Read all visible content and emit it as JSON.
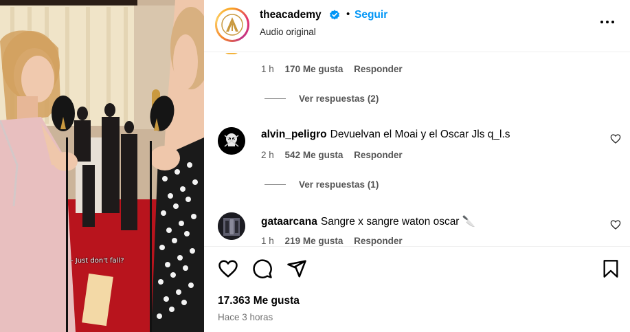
{
  "video": {
    "caption": "- Just don't fall?"
  },
  "header": {
    "username": "theacademy",
    "separator": "•",
    "follow_label": "Seguir",
    "subtitle": "Audio original",
    "more_icon": "more-horizontal-icon",
    "verified_icon": "verified-badge-icon"
  },
  "comments": {
    "top": {
      "time": "1 h",
      "likes": "170 Me gusta",
      "reply": "Responder",
      "view_replies": "Ver respuestas (2)"
    },
    "items": [
      {
        "username": "alvin_peligro",
        "text": "Devuelvan el Moai y el Oscar Jls q_l.s",
        "time": "2 h",
        "likes": "542 Me gusta",
        "reply": "Responder",
        "view_replies": "Ver respuestas (1)"
      },
      {
        "username": "gataarcana",
        "text": "Sangre x sangre waton oscar 🔪",
        "time": "1 h",
        "likes": "219 Me gusta",
        "reply": "Responder"
      }
    ]
  },
  "actions": {
    "likes": "17.363 Me gusta",
    "time_ago": "Hace 3 horas",
    "icons": [
      "heart-icon",
      "comment-icon",
      "share-icon",
      "bookmark-icon"
    ]
  },
  "colors": {
    "accent": "#0095f6",
    "verified": "#0095f6",
    "muted": "#737373"
  }
}
